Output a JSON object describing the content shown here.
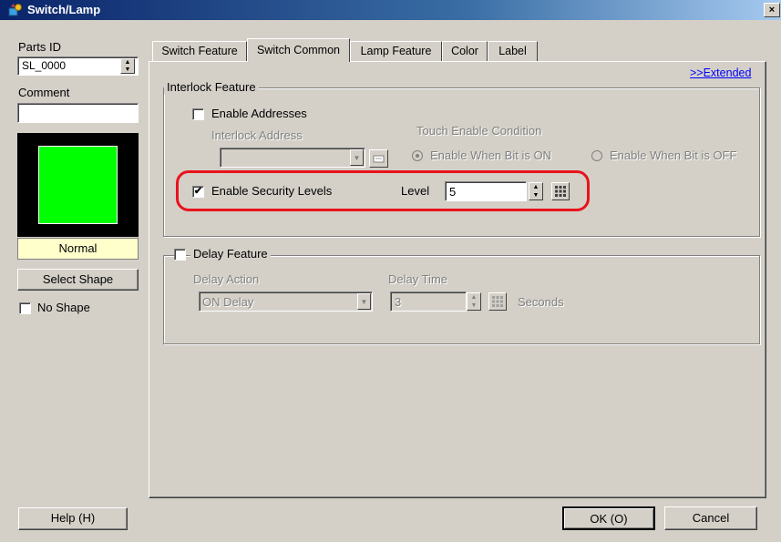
{
  "window": {
    "title": "Switch/Lamp",
    "close_label": "×"
  },
  "left": {
    "parts_id_label": "Parts ID",
    "parts_id_value": "SL_0000",
    "comment_label": "Comment",
    "comment_value": "",
    "preview_state": "Normal",
    "preview_color": "#00ff00",
    "select_shape_label": "Select Shape",
    "no_shape_label": "No Shape"
  },
  "tabs": [
    {
      "label": "Switch Feature"
    },
    {
      "label": "Switch Common"
    },
    {
      "label": "Lamp Feature"
    },
    {
      "label": "Color"
    },
    {
      "label": "Label"
    }
  ],
  "extended_link": ">>Extended",
  "interlock": {
    "title": "Interlock Feature",
    "enable_addresses_label": "Enable Addresses",
    "interlock_address_label": "Interlock Address",
    "touch_enable_label": "Touch Enable Condition",
    "radio_on_label": "Enable When Bit is ON",
    "radio_off_label": "Enable When Bit is OFF",
    "enable_security_label": "Enable Security Levels",
    "level_label": "Level",
    "level_value": "5"
  },
  "delay": {
    "title": "Delay Feature",
    "action_label": "Delay Action",
    "action_value": "ON Delay",
    "time_label": "Delay Time",
    "time_value": "3",
    "seconds_label": "Seconds"
  },
  "footer": {
    "help_label": "Help (H)",
    "ok_label": "OK (O)",
    "cancel_label": "Cancel"
  },
  "colors": {
    "highlight": "#e8131b",
    "title_bar": "#0a246a"
  }
}
